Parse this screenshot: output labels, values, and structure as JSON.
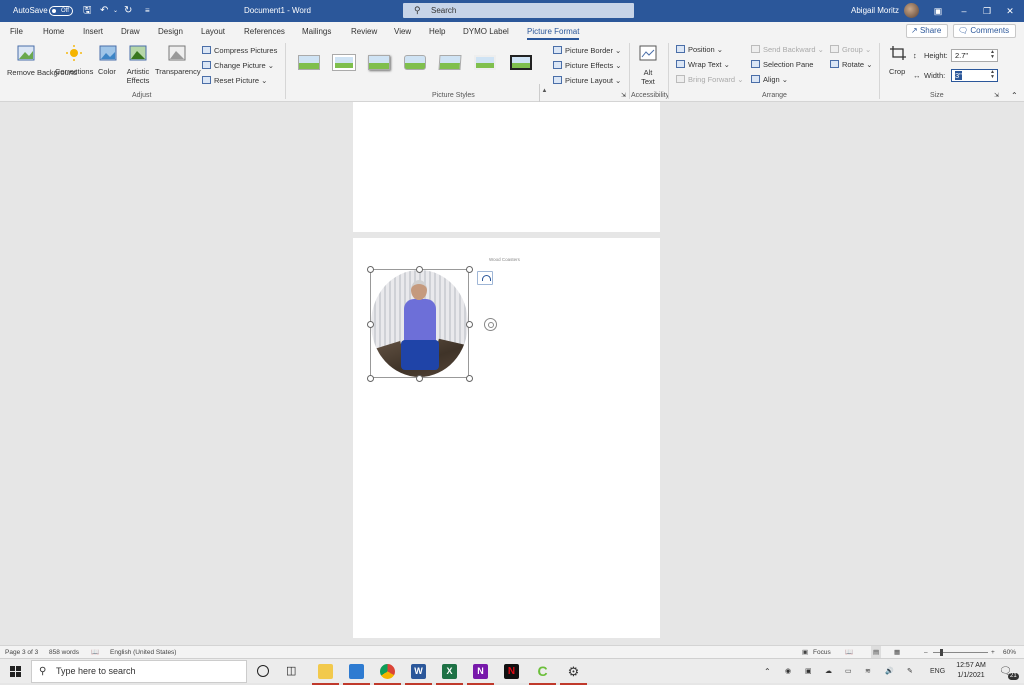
{
  "titlebar": {
    "autosave_label": "AutoSave",
    "autosave_state": "Off",
    "doc_title": "Document1  -  Word",
    "search_placeholder": "Search",
    "user_name": "Abigail Moritz"
  },
  "menu": {
    "tabs": [
      "File",
      "Home",
      "Insert",
      "Draw",
      "Design",
      "Layout",
      "References",
      "Mailings",
      "Review",
      "View",
      "Help",
      "DYMO Label",
      "Picture Format"
    ],
    "active_tab": "Picture Format",
    "share_label": "Share",
    "comments_label": "Comments"
  },
  "ribbon": {
    "adjust": {
      "remove_background": "Remove Background",
      "corrections": "Corrections",
      "color": "Color",
      "artistic_effects": "Artistic Effects",
      "transparency": "Transparency",
      "compress_pictures": "Compress Pictures",
      "change_picture": "Change Picture",
      "reset_picture": "Reset Picture",
      "group_label": "Adjust"
    },
    "picture_styles": {
      "picture_border": "Picture Border",
      "picture_effects": "Picture Effects",
      "picture_layout": "Picture Layout",
      "group_label": "Picture Styles"
    },
    "accessibility": {
      "alt_text": "Alt Text",
      "group_label": "Accessibility"
    },
    "arrange": {
      "position": "Position",
      "wrap_text": "Wrap Text",
      "bring_forward": "Bring Forward",
      "send_backward": "Send Backward",
      "selection_pane": "Selection Pane",
      "align": "Align",
      "group": "Group",
      "rotate": "Rotate",
      "group_label": "Arrange"
    },
    "size": {
      "crop": "Crop",
      "height_label": "Height:",
      "height_value": "2.7\"",
      "width_label": "Width:",
      "width_value": "3\"",
      "group_label": "Size"
    }
  },
  "document": {
    "header_text": "Wood Coasters"
  },
  "statusbar": {
    "page": "Page 3 of 3",
    "words": "858 words",
    "language": "English (United States)",
    "focus": "Focus",
    "zoom": "60%"
  },
  "taskbar": {
    "search_placeholder": "Type here to search",
    "language": "ENG",
    "time": "12:57 AM",
    "date": "1/1/2021",
    "notifications": "21"
  }
}
